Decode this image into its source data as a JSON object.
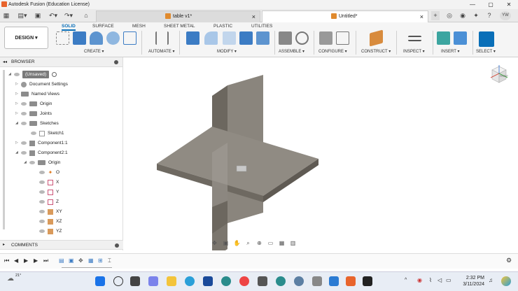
{
  "title_bar": {
    "title": "Autodesk Fusion (Education License)",
    "minimize": "—",
    "maximize": "▢",
    "close": "✕"
  },
  "doc_tabs": [
    {
      "label": "table v1*"
    },
    {
      "label": "Untitled*"
    }
  ],
  "user_initials": "YW",
  "workspace": {
    "label": "DESIGN ▾"
  },
  "workspace_tabs": [
    "SOLID",
    "SURFACE",
    "MESH",
    "SHEET METAL",
    "PLASTIC",
    "UTILITIES"
  ],
  "tool_groups": [
    "CREATE ▾",
    "AUTOMATE ▾",
    "MODIFY ▾",
    "ASSEMBLE ▾",
    "CONFIGURE ▾",
    "CONSTRUCT ▾",
    "INSPECT ▾",
    "INSERT ▾",
    "SELECT ▾"
  ],
  "browser": {
    "header": "BROWSER",
    "root": "(Unsaved)",
    "items": [
      {
        "label": "Document Settings"
      },
      {
        "label": "Named Views"
      },
      {
        "label": "Origin"
      },
      {
        "label": "Joints"
      },
      {
        "label": "Sketches"
      },
      {
        "label": "Sketch1"
      },
      {
        "label": "Component1:1"
      },
      {
        "label": "Component2:1"
      },
      {
        "label": "Origin"
      },
      {
        "label": "O"
      },
      {
        "label": "X"
      },
      {
        "label": "Y"
      },
      {
        "label": "Z"
      },
      {
        "label": "XY"
      },
      {
        "label": "XZ"
      },
      {
        "label": "YZ"
      }
    ]
  },
  "comments": {
    "label": "COMMENTS"
  },
  "viewcube": {
    "label": "FRONT"
  },
  "clock": {
    "time": "2:32 PM",
    "date": "3/11/2024"
  },
  "weather": {
    "temp": "21°"
  },
  "colors": {
    "accent": "#0a6fb8",
    "orange": "#e8642c",
    "model": "#8a857d"
  }
}
